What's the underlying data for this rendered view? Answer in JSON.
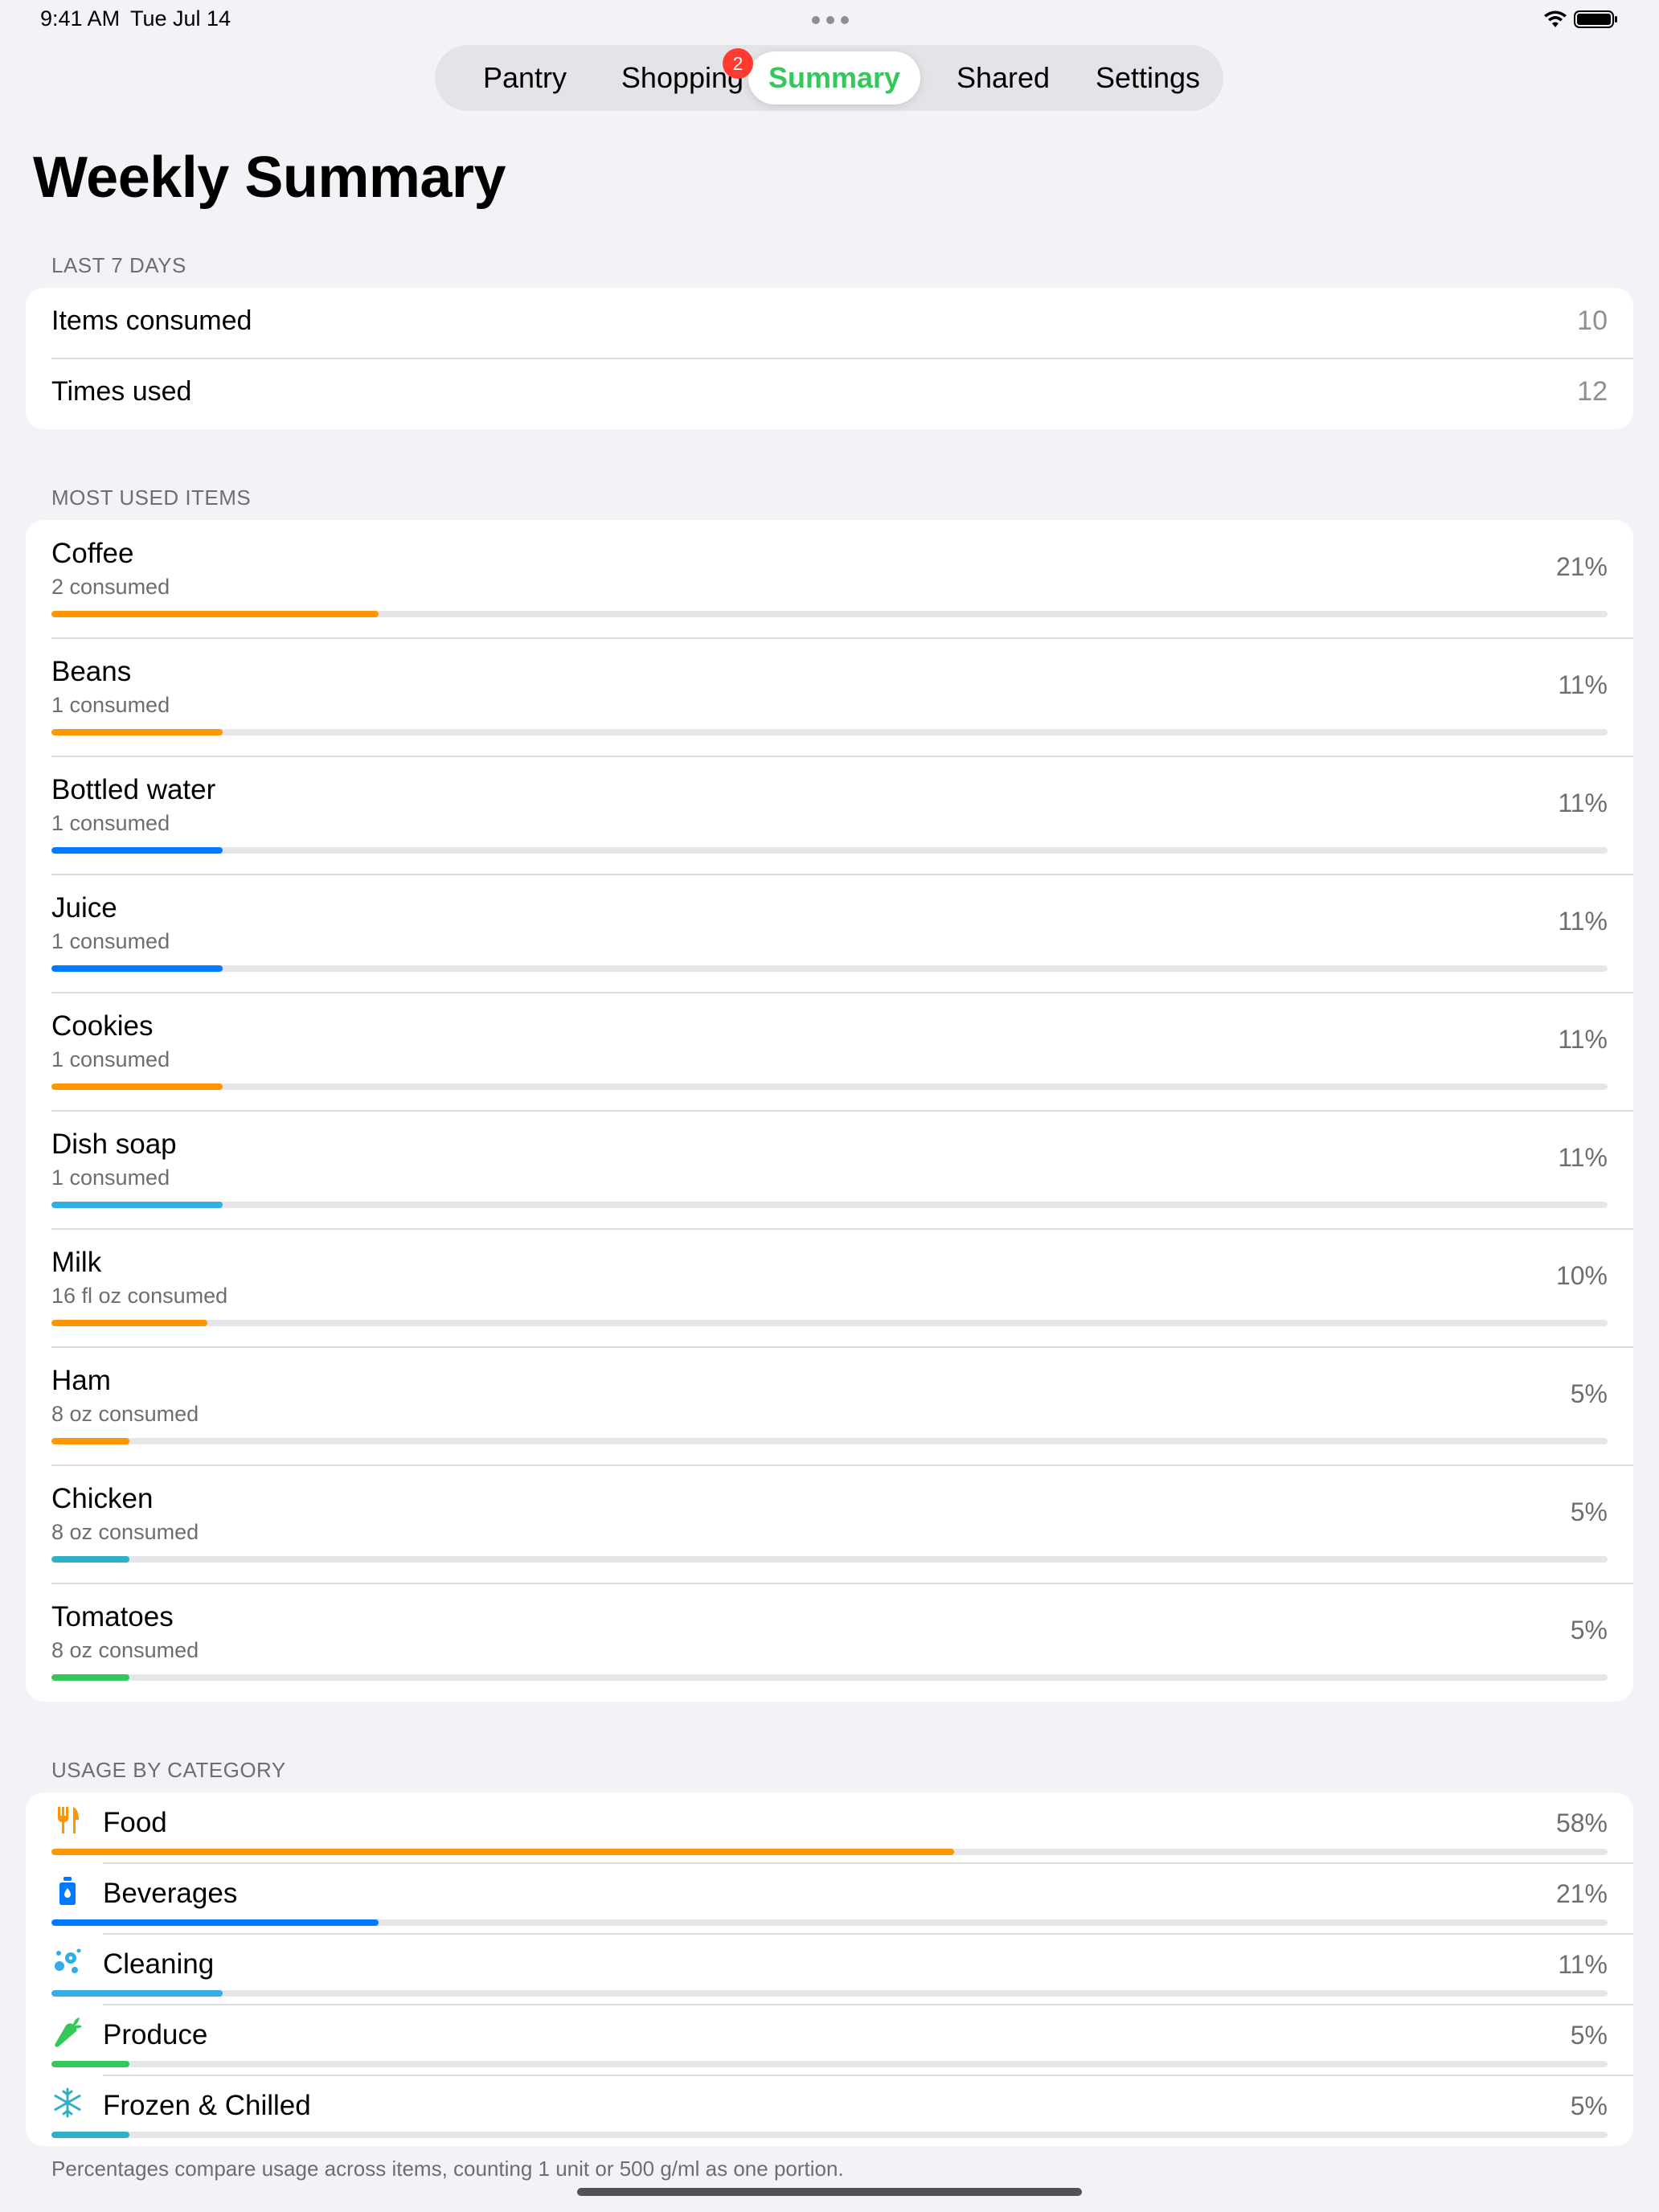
{
  "status_bar": {
    "time": "9:41 AM",
    "date": "Tue Jul 14"
  },
  "tabs": [
    {
      "label": "Pantry",
      "active": false
    },
    {
      "label": "Shopping",
      "active": false,
      "badge": "2"
    },
    {
      "label": "Summary",
      "active": true
    },
    {
      "label": "Shared",
      "active": false
    },
    {
      "label": "Settings",
      "active": false
    }
  ],
  "page_title": "Weekly Summary",
  "last7": {
    "header": "LAST 7 DAYS",
    "rows": [
      {
        "label": "Items consumed",
        "value": "10"
      },
      {
        "label": "Times used",
        "value": "12"
      }
    ]
  },
  "most_used": {
    "header": "MOST USED ITEMS",
    "items": [
      {
        "name": "Coffee",
        "sub": "2 consumed",
        "pct": "21%",
        "fraction": 0.21,
        "color": "#ff9500"
      },
      {
        "name": "Beans",
        "sub": "1 consumed",
        "pct": "11%",
        "fraction": 0.11,
        "color": "#ff9500"
      },
      {
        "name": "Bottled water",
        "sub": "1 consumed",
        "pct": "11%",
        "fraction": 0.11,
        "color": "#007aff"
      },
      {
        "name": "Juice",
        "sub": "1 consumed",
        "pct": "11%",
        "fraction": 0.11,
        "color": "#007aff"
      },
      {
        "name": "Cookies",
        "sub": "1 consumed",
        "pct": "11%",
        "fraction": 0.11,
        "color": "#ff9500"
      },
      {
        "name": "Dish soap",
        "sub": "1 consumed",
        "pct": "11%",
        "fraction": 0.11,
        "color": "#32ade6"
      },
      {
        "name": "Milk",
        "sub": "16 fl oz consumed",
        "pct": "10%",
        "fraction": 0.1,
        "color": "#ff9500"
      },
      {
        "name": "Ham",
        "sub": "8 oz consumed",
        "pct": "5%",
        "fraction": 0.05,
        "color": "#ff9500"
      },
      {
        "name": "Chicken",
        "sub": "8 oz consumed",
        "pct": "5%",
        "fraction": 0.05,
        "color": "#30b0c7"
      },
      {
        "name": "Tomatoes",
        "sub": "8 oz consumed",
        "pct": "5%",
        "fraction": 0.05,
        "color": "#34c759"
      }
    ]
  },
  "usage_by_category": {
    "header": "USAGE BY CATEGORY",
    "items": [
      {
        "name": "Food",
        "icon": "fork-knife-icon",
        "pct": "58%",
        "fraction": 0.58,
        "color": "#ff9500"
      },
      {
        "name": "Beverages",
        "icon": "bottle-icon",
        "pct": "21%",
        "fraction": 0.21,
        "color": "#007aff"
      },
      {
        "name": "Cleaning",
        "icon": "bubbles-icon",
        "pct": "11%",
        "fraction": 0.11,
        "color": "#32ade6"
      },
      {
        "name": "Produce",
        "icon": "carrot-icon",
        "pct": "5%",
        "fraction": 0.05,
        "color": "#34c759"
      },
      {
        "name": "Frozen & Chilled",
        "icon": "snowflake-icon",
        "pct": "5%",
        "fraction": 0.05,
        "color": "#30b0c7"
      }
    ]
  },
  "footer_note": "Percentages compare usage across items, counting 1 unit or 500 g/ml as one portion."
}
